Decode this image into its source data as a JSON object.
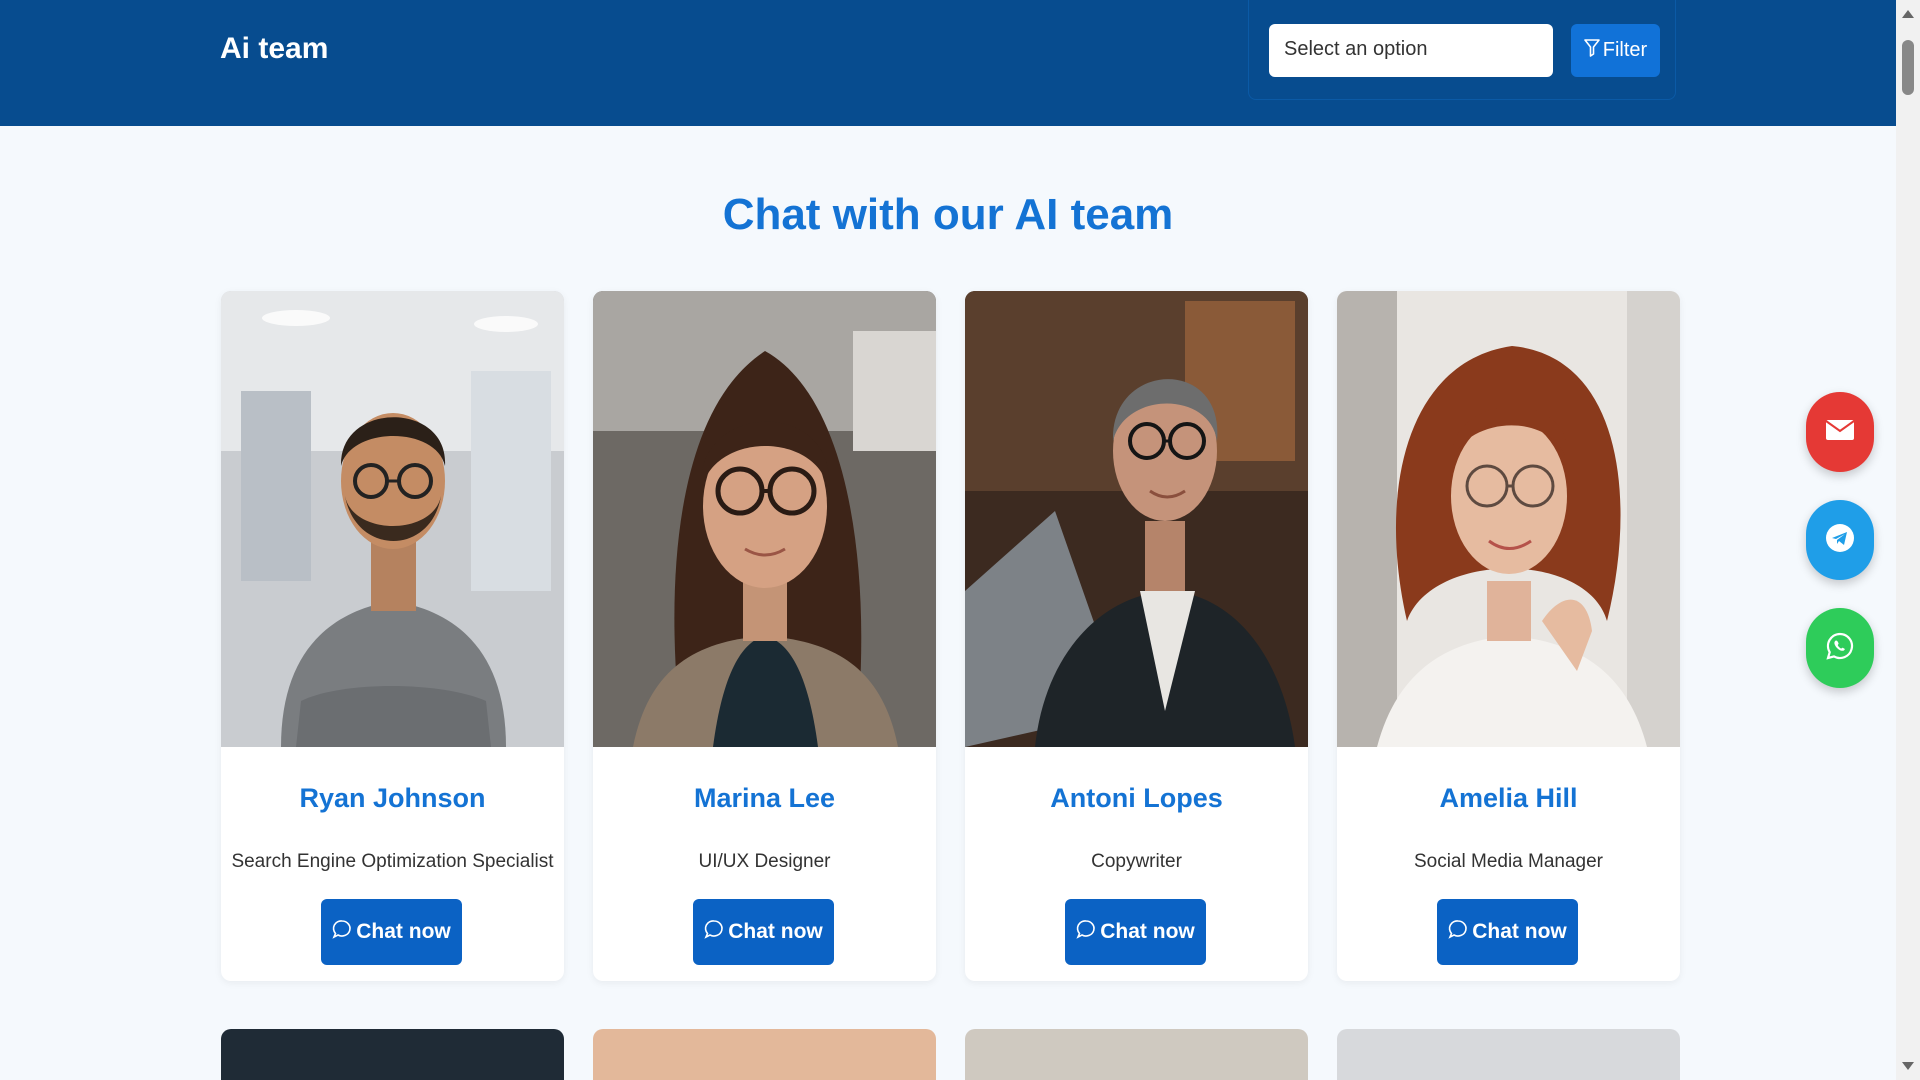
{
  "header": {
    "brand": "Ai team",
    "select_placeholder": "Select an option",
    "filter_label": "Filter"
  },
  "main": {
    "title": "Chat with our AI team",
    "chat_label": "Chat now",
    "members": [
      {
        "name": "Ryan Johnson",
        "role": "Search Engine Optimization Specialist"
      },
      {
        "name": "Marina Lee",
        "role": "UI/UX Designer"
      },
      {
        "name": "Antoni Lopes",
        "role": "Copywriter"
      },
      {
        "name": "Amelia Hill",
        "role": "Social Media Manager"
      }
    ]
  },
  "contact": {
    "icons": [
      "envelope-icon",
      "telegram-icon",
      "whatsapp-icon"
    ],
    "colors": {
      "email": "#e53935",
      "telegram": "#1f9ee8",
      "whatsapp": "#2ecc5a"
    }
  },
  "colors": {
    "header_bg": "#074c8f",
    "accent": "#1473d4",
    "button": "#0b62c4"
  }
}
